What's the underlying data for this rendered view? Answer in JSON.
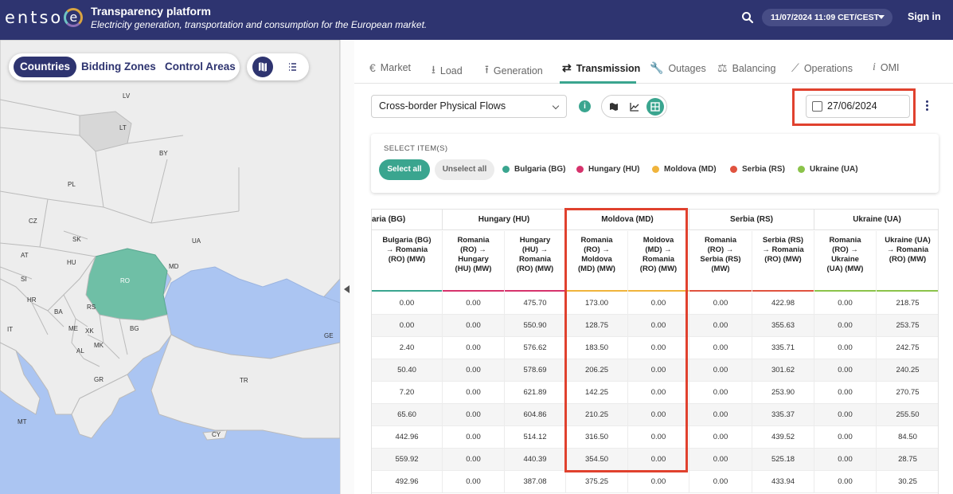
{
  "header": {
    "logo_text": "entso",
    "logo_e": "e",
    "title": "Transparency platform",
    "subtitle": "Electricity generation, transportation and consumption for the European market.",
    "datetime": "11/07/2024 11:09 CET/CEST",
    "signin": "Sign in"
  },
  "map": {
    "tabs": [
      "Countries",
      "Bidding Zones",
      "Control Areas"
    ],
    "active_tab": "Countries",
    "labels": {
      "lv": "LV",
      "lt": "LT",
      "by": "BY",
      "pl": "PL",
      "cz": "CZ",
      "sk": "SK",
      "ua": "UA",
      "at": "AT",
      "hu": "HU",
      "md": "MD",
      "si": "SI",
      "ro": "RO",
      "hr": "HR",
      "ba": "BA",
      "rs": "RS",
      "it": "IT",
      "me": "ME",
      "xk": "XK",
      "bg": "BG",
      "mk": "MK",
      "al": "AL",
      "ge": "GE",
      "gr": "GR",
      "tr": "TR",
      "mt": "MT",
      "cy": "CY"
    },
    "colors": {
      "sea": "#abc5f2",
      "land": "#ededed",
      "selected": "#6fbfa6"
    }
  },
  "nav": {
    "tabs": [
      {
        "label": "Market",
        "icon": "euro-icon"
      },
      {
        "label": "Load",
        "icon": "download-icon"
      },
      {
        "label": "Generation",
        "icon": "upload-icon"
      },
      {
        "label": "Transmission",
        "icon": "swap-icon"
      },
      {
        "label": "Outages",
        "icon": "wrench-icon"
      },
      {
        "label": "Balancing",
        "icon": "scale-icon"
      },
      {
        "label": "Operations",
        "icon": "trend-icon"
      },
      {
        "label": "OMI",
        "icon": "info-italic-icon"
      }
    ],
    "active": "Transmission"
  },
  "controls": {
    "dataset": "Cross-border Physical Flows",
    "date": "27/06/2024"
  },
  "items": {
    "title": "SELECT ITEM(S)",
    "select_all": "Select all",
    "unselect_all": "Unselect all",
    "legend": [
      {
        "label": "Bulgaria (BG)",
        "color": "#3aa58f"
      },
      {
        "label": "Hungary (HU)",
        "color": "#d6336c"
      },
      {
        "label": "Moldova (MD)",
        "color": "#f0b43c"
      },
      {
        "label": "Serbia (RS)",
        "color": "#e0533f"
      },
      {
        "label": "Ukraine (UA)",
        "color": "#8bc34a"
      }
    ]
  },
  "table": {
    "groups": [
      "aria (BG)",
      "Hungary (HU)",
      "Moldova (MD)",
      "Serbia (RS)",
      "Ukraine (UA)"
    ],
    "columns": [
      "Bulgaria (BG) → Romania (RO) (MW)",
      "Romania (RO) → Hungary (HU) (MW)",
      "Hungary (HU) → Romania (RO) (MW)",
      "Romania (RO) → Moldova (MD) (MW)",
      "Moldova (MD) → Romania (RO) (MW)",
      "Romania (RO) → Serbia (RS) (MW)",
      "Serbia (RS) → Romania (RO) (MW)",
      "Romania (RO) → Ukraine (UA) (MW)",
      "Ukraine (UA) → Romania (RO) (MW)"
    ],
    "rows": [
      [
        "0.00",
        "0.00",
        "475.70",
        "173.00",
        "0.00",
        "0.00",
        "422.98",
        "0.00",
        "218.75"
      ],
      [
        "0.00",
        "0.00",
        "550.90",
        "128.75",
        "0.00",
        "0.00",
        "355.63",
        "0.00",
        "253.75"
      ],
      [
        "2.40",
        "0.00",
        "576.62",
        "183.50",
        "0.00",
        "0.00",
        "335.71",
        "0.00",
        "242.75"
      ],
      [
        "50.40",
        "0.00",
        "578.69",
        "206.25",
        "0.00",
        "0.00",
        "301.62",
        "0.00",
        "240.25"
      ],
      [
        "7.20",
        "0.00",
        "621.89",
        "142.25",
        "0.00",
        "0.00",
        "253.90",
        "0.00",
        "270.75"
      ],
      [
        "65.60",
        "0.00",
        "604.86",
        "210.25",
        "0.00",
        "0.00",
        "335.37",
        "0.00",
        "255.50"
      ],
      [
        "442.96",
        "0.00",
        "514.12",
        "316.50",
        "0.00",
        "0.00",
        "439.52",
        "0.00",
        "84.50"
      ],
      [
        "559.92",
        "0.00",
        "440.39",
        "354.50",
        "0.00",
        "0.00",
        "525.18",
        "0.00",
        "28.75"
      ],
      [
        "492.96",
        "0.00",
        "387.08",
        "375.25",
        "0.00",
        "0.00",
        "433.94",
        "0.00",
        "30.25"
      ]
    ]
  }
}
